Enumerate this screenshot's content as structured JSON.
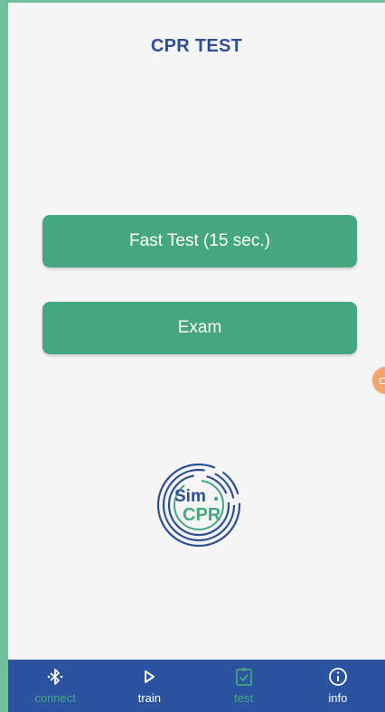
{
  "header": {
    "title": "CPR TEST"
  },
  "actions": {
    "fast_test_label": "Fast Test (15 sec.)",
    "exam_label": "Exam"
  },
  "logo": {
    "line1": "Sim",
    "line2": "CPR"
  },
  "nav": {
    "items": [
      {
        "label": "connect",
        "icon": "bluetooth-icon"
      },
      {
        "label": "train",
        "icon": "play-icon"
      },
      {
        "label": "test",
        "icon": "clipboard-check-icon"
      },
      {
        "label": "info",
        "icon": "info-icon"
      }
    ]
  },
  "colors": {
    "brand_blue": "#2c4f96",
    "brand_green": "#45a77f",
    "nav_bg": "#2c53a0",
    "accent_orange": "#f3a56a"
  }
}
